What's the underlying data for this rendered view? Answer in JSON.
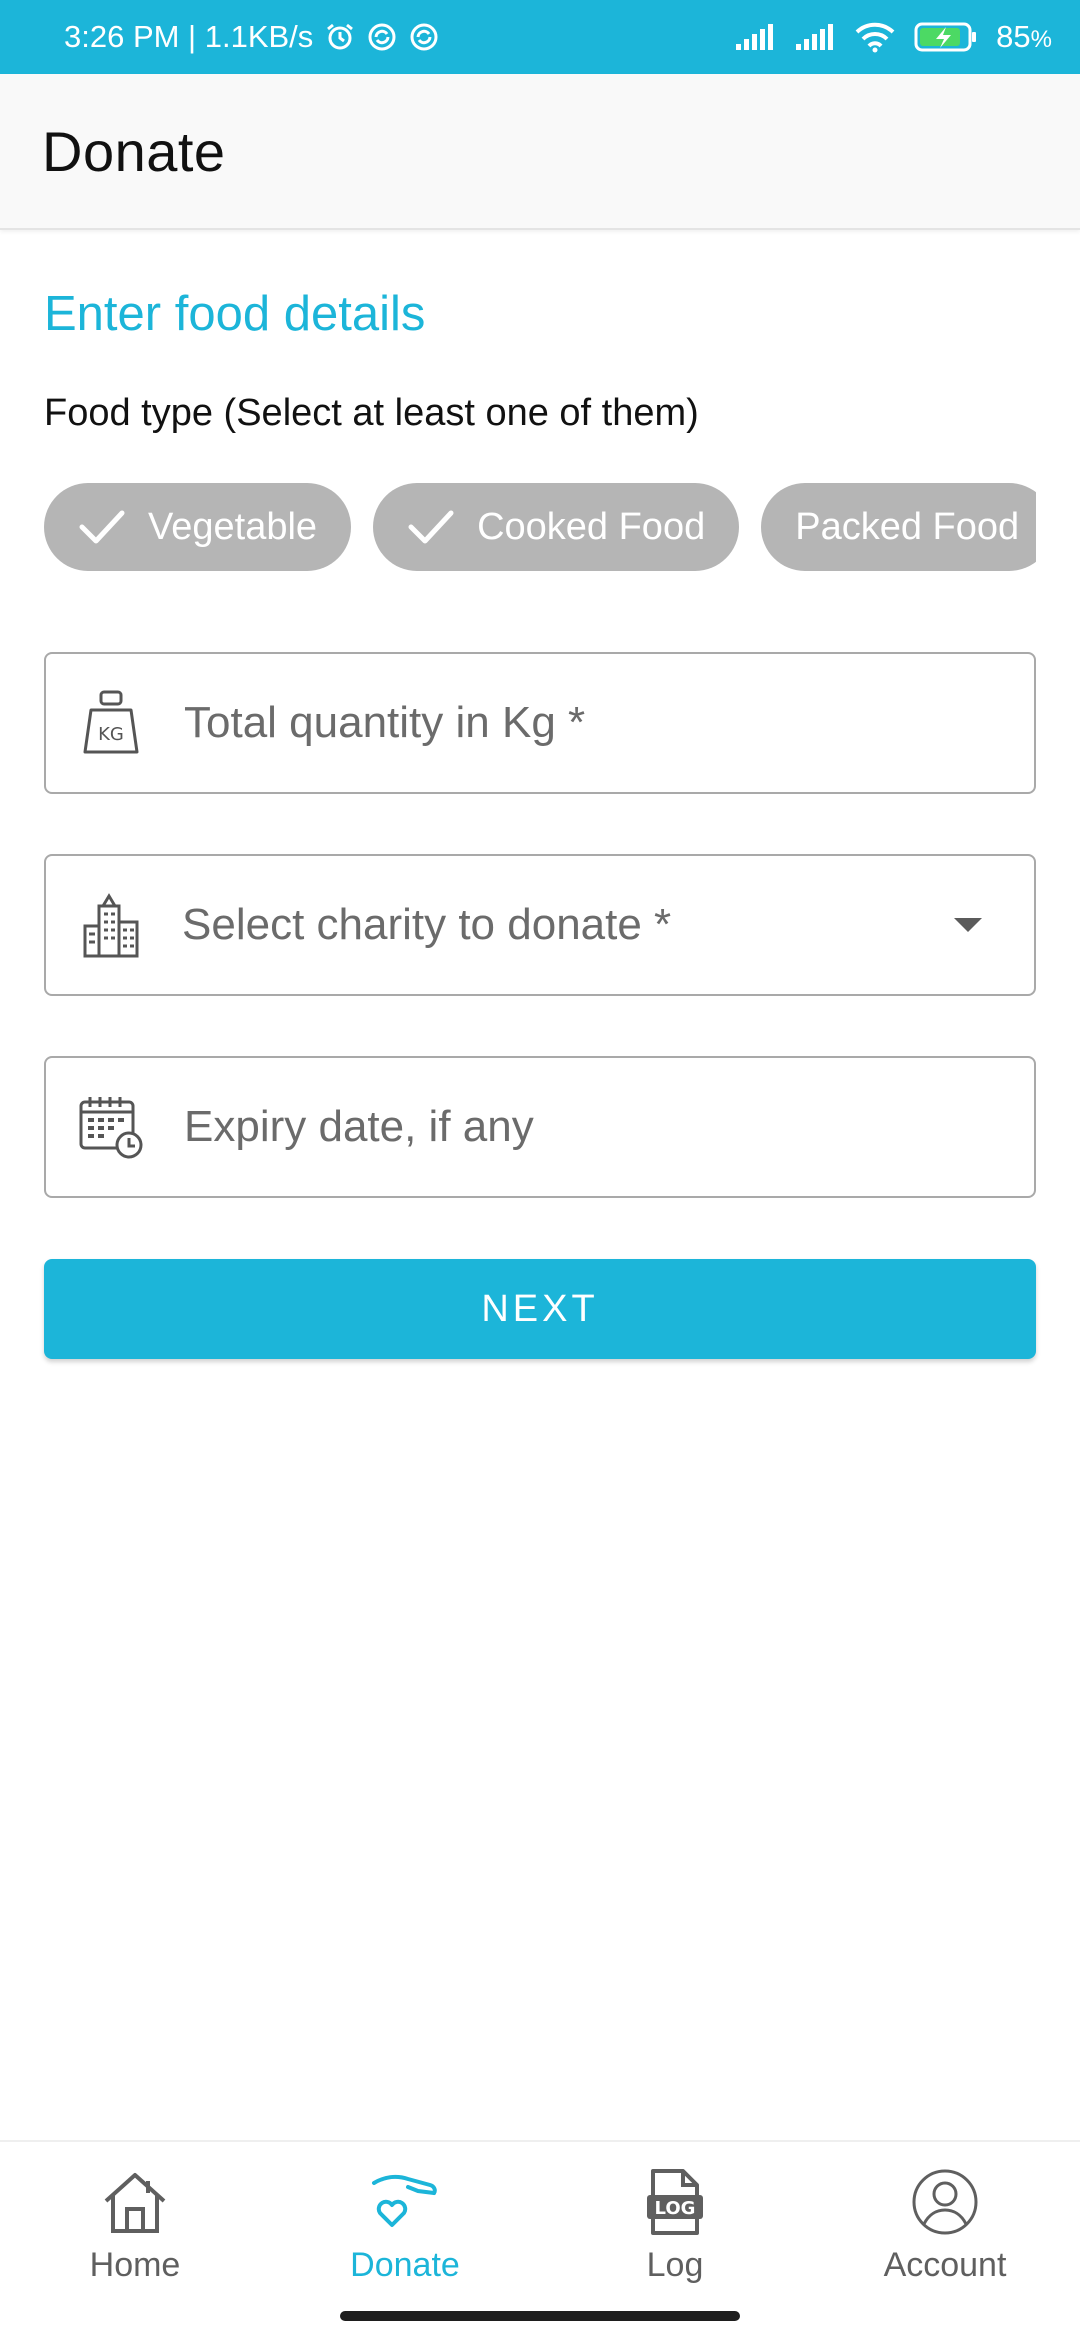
{
  "status_bar": {
    "time_speed": "3:26 PM | 1.1KB/s",
    "battery": "85",
    "battery_unit": "%",
    "icons": [
      "alarm-icon",
      "sync-icon",
      "sync-icon",
      "signal-icon",
      "signal-icon",
      "wifi-icon",
      "battery-charging-icon"
    ]
  },
  "app_bar": {
    "title": "Donate"
  },
  "form": {
    "section_title": "Enter food details",
    "food_type_label": "Food type (Select at least one of them)",
    "chips": [
      {
        "label": "Vegetable",
        "selected": true
      },
      {
        "label": "Cooked Food",
        "selected": true
      },
      {
        "label": "Packed Food",
        "selected": false
      }
    ],
    "quantity_placeholder": "Total quantity in Kg *",
    "charity_placeholder": "Select charity to donate *",
    "expiry_placeholder": "Expiry date, if any",
    "next_label": "NEXT"
  },
  "bottom_nav": {
    "items": [
      {
        "label": "Home",
        "icon": "home-icon",
        "active": false
      },
      {
        "label": "Donate",
        "icon": "donate-hand-heart-icon",
        "active": true
      },
      {
        "label": "Log",
        "icon": "log-file-icon",
        "active": false
      },
      {
        "label": "Account",
        "icon": "account-icon",
        "active": false
      }
    ]
  },
  "colors": {
    "accent": "#1cb5d9",
    "chip": "#b5b5b5",
    "border": "#a9a9a9"
  }
}
